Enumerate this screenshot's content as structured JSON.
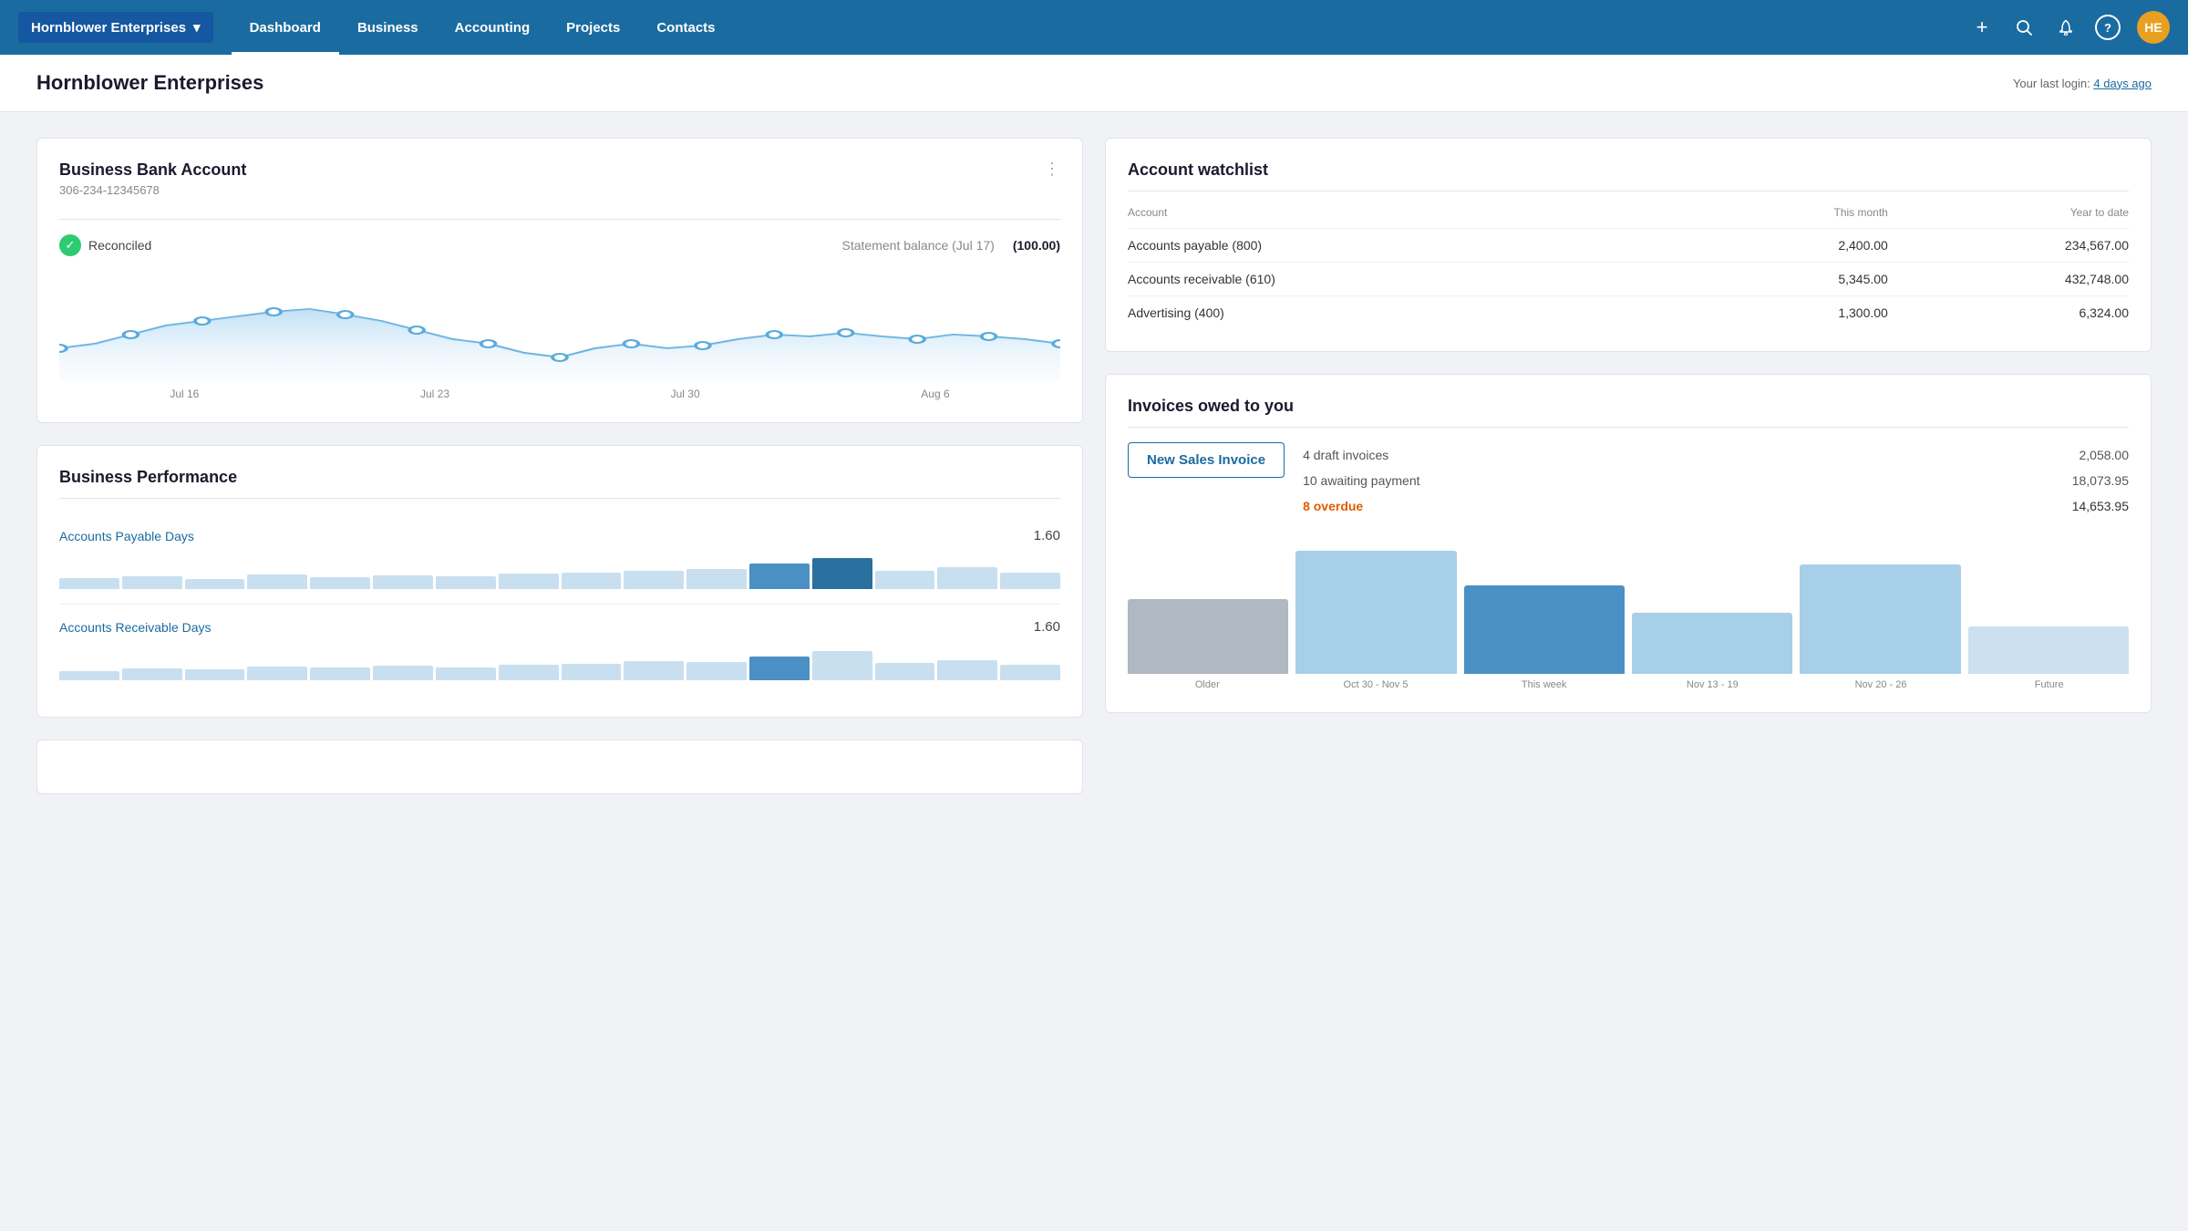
{
  "nav": {
    "brand": "Hornblower Enterprises",
    "chevron": "▾",
    "links": [
      {
        "label": "Dashboard",
        "active": true
      },
      {
        "label": "Business",
        "active": false
      },
      {
        "label": "Accounting",
        "active": false
      },
      {
        "label": "Projects",
        "active": false
      },
      {
        "label": "Contacts",
        "active": false
      }
    ],
    "avatar_initials": "HE",
    "add_icon": "+",
    "search_icon": "🔍",
    "bell_icon": "🔔",
    "help_icon": "?"
  },
  "page": {
    "title": "Hornblower Enterprises",
    "last_login_label": "Your last login:",
    "last_login_value": "4 days ago"
  },
  "bank_card": {
    "title": "Business Bank Account",
    "account_number": "306-234-12345678",
    "reconciled_label": "Reconciled",
    "statement_label": "Statement balance (Jul 17)",
    "statement_value": "(100.00)",
    "chart_labels": [
      "Jul 16",
      "Jul 23",
      "Jul 30",
      "Aug 6"
    ],
    "menu_icon": "⋮"
  },
  "perf_card": {
    "title": "Business Performance",
    "rows": [
      {
        "label": "Accounts Payable Days",
        "value": "1.60"
      },
      {
        "label": "Accounts Receivable Days",
        "value": "1.60"
      }
    ]
  },
  "watchlist_card": {
    "title": "Account watchlist",
    "columns": [
      "Account",
      "This month",
      "Year to date"
    ],
    "rows": [
      {
        "account": "Accounts payable (800)",
        "this_month": "2,400.00",
        "ytd": "234,567.00"
      },
      {
        "account": "Accounts receivable (610)",
        "this_month": "5,345.00",
        "ytd": "432,748.00"
      },
      {
        "account": "Advertising (400)",
        "this_month": "1,300.00",
        "ytd": "6,324.00"
      }
    ]
  },
  "invoices_card": {
    "title": "Invoices owed to you",
    "new_invoice_btn": "New Sales Invoice",
    "draft_label": "4 draft invoices",
    "draft_amount": "2,058.00",
    "awaiting_label": "10 awaiting payment",
    "awaiting_amount": "18,073.95",
    "overdue_label": "8 overdue",
    "overdue_amount": "14,653.95",
    "bar_labels": [
      "Older",
      "Oct 30 - Nov 5",
      "This week",
      "Nov 13 - 19",
      "Nov 20 - 26",
      "Future"
    ],
    "bars": [
      {
        "height_pct": 55,
        "color": "#b0b8c1"
      },
      {
        "height_pct": 90,
        "color": "#a8cfe8"
      },
      {
        "height_pct": 65,
        "color": "#4a90c4"
      },
      {
        "height_pct": 45,
        "color": "#a8cfe8"
      },
      {
        "height_pct": 80,
        "color": "#a8cfe8"
      },
      {
        "height_pct": 35,
        "color": "#cce0f0"
      }
    ]
  }
}
